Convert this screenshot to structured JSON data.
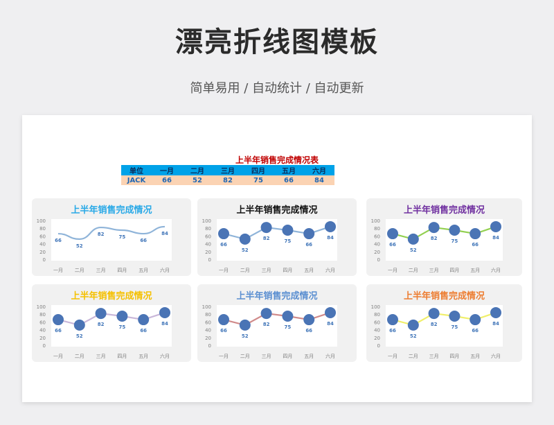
{
  "page": {
    "title": "漂亮折线图模板",
    "subtitle": "简单易用 / 自动统计 / 自动更新"
  },
  "table": {
    "title": "上半年销售完成情况表",
    "headers": [
      "单位",
      "一月",
      "二月",
      "三月",
      "四月",
      "五月",
      "六月"
    ],
    "row": [
      "JACK",
      "66",
      "52",
      "82",
      "75",
      "66",
      "84"
    ]
  },
  "chart_data": [
    {
      "type": "line",
      "title": "上半年销售完成情况",
      "title_color": "#29a9e7",
      "line_color": "#8fb4d9",
      "markers": false,
      "smooth": true,
      "categories": [
        "一月",
        "二月",
        "三月",
        "四月",
        "五月",
        "六月"
      ],
      "values": [
        66,
        52,
        82,
        75,
        66,
        84
      ],
      "ylim": [
        0,
        100
      ],
      "yticks": [
        0,
        20,
        40,
        60,
        80,
        100
      ]
    },
    {
      "type": "line",
      "title": "上半年销售完成情况",
      "title_color": "#111111",
      "line_color": "#8fb4d9",
      "markers": true,
      "smooth": false,
      "categories": [
        "一月",
        "二月",
        "三月",
        "四月",
        "五月",
        "六月"
      ],
      "values": [
        66,
        52,
        82,
        75,
        66,
        84
      ],
      "ylim": [
        0,
        100
      ],
      "yticks": [
        0,
        20,
        40,
        60,
        80,
        100
      ]
    },
    {
      "type": "line",
      "title": "上半年销售完成情况",
      "title_color": "#7030a0",
      "line_color": "#92d050",
      "markers": true,
      "smooth": false,
      "categories": [
        "一月",
        "二月",
        "三月",
        "四月",
        "五月",
        "六月"
      ],
      "values": [
        66,
        52,
        82,
        75,
        66,
        84
      ],
      "ylim": [
        0,
        100
      ],
      "yticks": [
        0,
        20,
        40,
        60,
        80,
        100
      ]
    },
    {
      "type": "line",
      "title": "上半年销售完成情况",
      "title_color": "#f5c000",
      "line_color": "#c9b7d9",
      "markers": true,
      "smooth": false,
      "categories": [
        "一月",
        "二月",
        "三月",
        "四月",
        "五月",
        "六月"
      ],
      "values": [
        66,
        52,
        82,
        75,
        66,
        84
      ],
      "ylim": [
        0,
        100
      ],
      "yticks": [
        0,
        20,
        40,
        60,
        80,
        100
      ]
    },
    {
      "type": "line",
      "title": "上半年销售完成情况",
      "title_color": "#5b8fd1",
      "line_color": "#d08a8a",
      "markers": true,
      "smooth": false,
      "categories": [
        "一月",
        "二月",
        "三月",
        "四月",
        "五月",
        "六月"
      ],
      "values": [
        66,
        52,
        82,
        75,
        66,
        84
      ],
      "ylim": [
        0,
        100
      ],
      "yticks": [
        0,
        20,
        40,
        60,
        80,
        100
      ]
    },
    {
      "type": "line",
      "title": "上半年销售完成情况",
      "title_color": "#ed7d31",
      "line_color": "#f0ef6a",
      "markers": true,
      "smooth": false,
      "categories": [
        "一月",
        "二月",
        "三月",
        "四月",
        "五月",
        "六月"
      ],
      "values": [
        66,
        52,
        82,
        75,
        66,
        84
      ],
      "ylim": [
        0,
        100
      ],
      "yticks": [
        0,
        20,
        40,
        60,
        80,
        100
      ]
    }
  ],
  "colors": {
    "marker": "#4a74b5",
    "value_label": "#3f74b8",
    "axis_text": "#7f7f7f"
  }
}
